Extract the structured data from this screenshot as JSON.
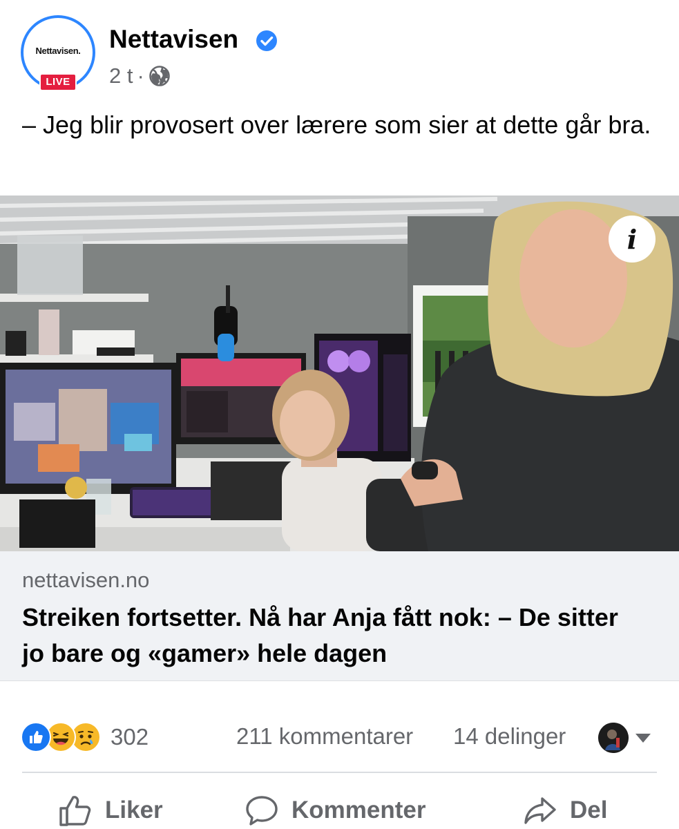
{
  "post": {
    "page_name": "Nettavisen",
    "avatar_logo_text": "Nettavisen.",
    "live_label": "LIVE",
    "time": "2 t",
    "separator": "·",
    "text": "– Jeg blir provosert over lærere som sier at dette går bra."
  },
  "image": {
    "info_label": "i"
  },
  "link": {
    "domain": "nettavisen.no",
    "title": "Streiken fortsetter. Nå har Anja fått nok: – De sitter jo bare og «gamer» hele dagen"
  },
  "engagement": {
    "reaction_icons": [
      "like-icon",
      "haha-icon",
      "sad-icon"
    ],
    "reaction_count": "302",
    "comments": "211 kommentarer",
    "shares": "14 delinger"
  },
  "actions": {
    "like": "Liker",
    "comment": "Kommenter",
    "share": "Del"
  },
  "colors": {
    "accent": "#1877f2",
    "verified": "#2d86ff",
    "live": "#e41e3f",
    "secondary_text": "#65676b",
    "link_bg": "#f0f2f5"
  }
}
